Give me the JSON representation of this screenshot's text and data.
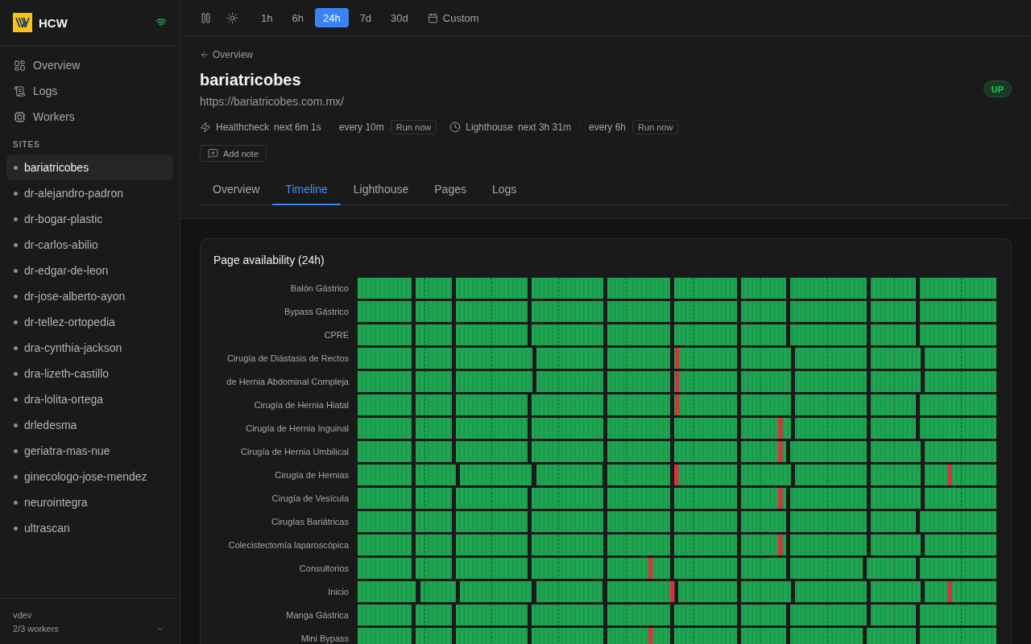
{
  "brand": {
    "name": "HCW"
  },
  "nav": [
    {
      "label": "Overview"
    },
    {
      "label": "Logs"
    },
    {
      "label": "Workers"
    }
  ],
  "sites": {
    "heading": "SITES",
    "items": [
      {
        "label": "bariatricobes",
        "selected": true
      },
      {
        "label": "dr-alejandro-padron",
        "selected": false
      },
      {
        "label": "dr-bogar-plastic",
        "selected": false
      },
      {
        "label": "dr-carlos-abilio",
        "selected": false
      },
      {
        "label": "dr-edgar-de-leon",
        "selected": false
      },
      {
        "label": "dr-jose-alberto-ayon",
        "selected": false
      },
      {
        "label": "dr-tellez-ortopedia",
        "selected": false
      },
      {
        "label": "dra-cynthia-jackson",
        "selected": false
      },
      {
        "label": "dra-lizeth-castillo",
        "selected": false
      },
      {
        "label": "dra-lolita-ortega",
        "selected": false
      },
      {
        "label": "drledesma",
        "selected": false
      },
      {
        "label": "geriatra-mas-nue",
        "selected": false
      },
      {
        "label": "ginecologo-jose-mendez",
        "selected": false
      },
      {
        "label": "neurointegra",
        "selected": false
      },
      {
        "label": "ultrascan",
        "selected": false
      }
    ]
  },
  "workspace": {
    "name": "vdev",
    "workers": "2/3 workers"
  },
  "toolbar": {
    "ranges": [
      {
        "label": "1h",
        "selected": false
      },
      {
        "label": "6h",
        "selected": false
      },
      {
        "label": "24h",
        "selected": true
      },
      {
        "label": "7d",
        "selected": false
      },
      {
        "label": "30d",
        "selected": false
      }
    ],
    "custom": "Custom"
  },
  "site": {
    "back": "Overview",
    "title": "bariatricobes",
    "url": "https://bariatricobes.com.mx/",
    "status": "UP",
    "checks": [
      {
        "name": "Healthcheck",
        "next": "next 6m 1s",
        "separator": "·",
        "interval": "every 10m",
        "action": "Run now"
      },
      {
        "name": "Lighthouse",
        "next": "next 3h 31m",
        "separator": "·",
        "interval": "every 6h",
        "action": "Run now"
      }
    ],
    "add_note": "Add note"
  },
  "tabs": [
    {
      "label": "Overview",
      "selected": false
    },
    {
      "label": "Timeline",
      "selected": true
    },
    {
      "label": "Lighthouse",
      "selected": false
    },
    {
      "label": "Pages",
      "selected": false
    },
    {
      "label": "Logs",
      "selected": false
    }
  ],
  "availability": {
    "title": "Page availability (24h)",
    "rows": [
      {
        "label": "Balón Gástrico"
      },
      {
        "label": "Bypass Gástrico"
      },
      {
        "label": "CPRE"
      },
      {
        "label": "Cirugía de Diástasis de Rectos"
      },
      {
        "label": "de Hernia Abdominal Compleja"
      },
      {
        "label": "Cirugía de Hernia Hiatal"
      },
      {
        "label": "Cirugía de Hernia Inguinal"
      },
      {
        "label": "Cirugía de Hernia Umbilical"
      },
      {
        "label": "Cirugía de Hernias"
      },
      {
        "label": "Cirugía de Vesícula"
      },
      {
        "label": "Cirugías Bariátricas"
      },
      {
        "label": "Colecistectomía laparoscópica"
      },
      {
        "label": "Consultorios"
      },
      {
        "label": "Inicio"
      },
      {
        "label": "Manga Gástrica"
      },
      {
        "label": "Mini Bypass"
      }
    ]
  }
}
